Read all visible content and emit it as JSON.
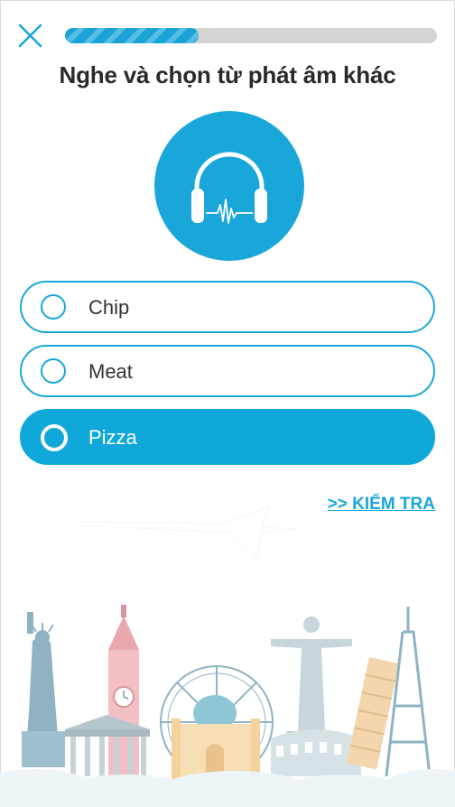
{
  "progress": {
    "fraction": 0.36
  },
  "question": {
    "title": "Nghe và chọn từ phát âm khác"
  },
  "audio": {
    "icon": "headphones-icon"
  },
  "options": [
    {
      "label": "Chip",
      "selected": false
    },
    {
      "label": "Meat",
      "selected": false
    },
    {
      "label": "Pizza",
      "selected": true
    }
  ],
  "actions": {
    "check_label": ">> KIỂM TRA"
  },
  "colors": {
    "accent": "#19a7d9",
    "track": "#d4d4d4",
    "title": "#2a2a2a"
  }
}
